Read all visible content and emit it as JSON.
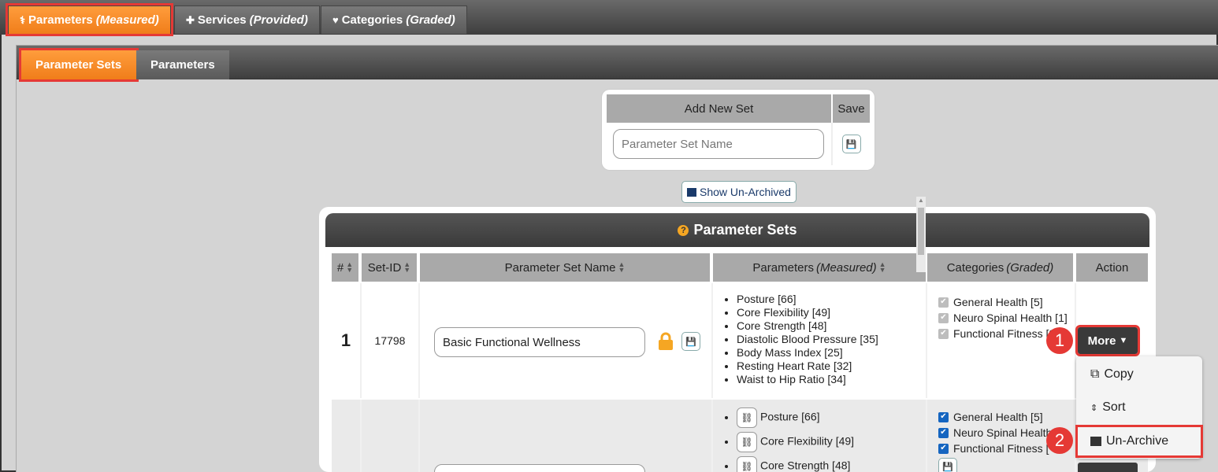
{
  "top_tabs": [
    {
      "label": "Parameters",
      "qualifier": "(Measured)",
      "icon": "stethoscope-icon"
    },
    {
      "label": "Services",
      "qualifier": "(Provided)",
      "icon": "medkit-icon"
    },
    {
      "label": "Categories",
      "qualifier": "(Graded)",
      "icon": "heartbeat-icon"
    }
  ],
  "sub_tabs": [
    {
      "label": "Parameter Sets"
    },
    {
      "label": "Parameters"
    }
  ],
  "add_set": {
    "header": "Add New Set",
    "save_header": "Save",
    "placeholder": "Parameter Set Name"
  },
  "show_unarchived_label": "Show Un-Archived",
  "panel_title": "Parameter Sets",
  "columns": [
    {
      "label": "#",
      "sortable": true
    },
    {
      "label": "Set-ID",
      "sortable": true
    },
    {
      "label": "Parameter Set Name",
      "sortable": true
    },
    {
      "label": "Parameters",
      "qualifier": "(Measured)",
      "sortable": true
    },
    {
      "label": "Categories",
      "qualifier": "(Graded)",
      "sortable": false
    },
    {
      "label": "Action",
      "sortable": false
    }
  ],
  "rows": [
    {
      "num": "1",
      "set_id": "17798",
      "name": "Basic Functional Wellness",
      "locked": true,
      "parameters": [
        "Posture [66]",
        "Core Flexibility [49]",
        "Core Strength [48]",
        "Diastolic Blood Pressure [35]",
        "Body Mass Index [25]",
        "Resting Heart Rate [32]",
        "Waist to Hip Ratio [34]"
      ],
      "categories": [
        "General Health [5]",
        "Neuro Spinal Health [1]",
        "Functional Fitness [2"
      ]
    },
    {
      "parameters": [
        "Posture [66]",
        "Core Flexibility [49]",
        "Core Strength [48]"
      ],
      "categories": [
        "General Health [5]",
        "Neuro Spinal Health",
        "Functional Fitness ["
      ]
    }
  ],
  "more_label": "More",
  "dropdown": [
    {
      "label": "Copy",
      "icon": "copy-icon"
    },
    {
      "label": "Sort",
      "icon": "sort-icon"
    },
    {
      "label": "Un-Archive",
      "icon": "archive-icon"
    }
  ],
  "badges": [
    "1",
    "2"
  ],
  "colors": {
    "accent_orange": "#f5891f",
    "highlight_red": "#e53935",
    "checkbox_blue": "#1565c0"
  }
}
